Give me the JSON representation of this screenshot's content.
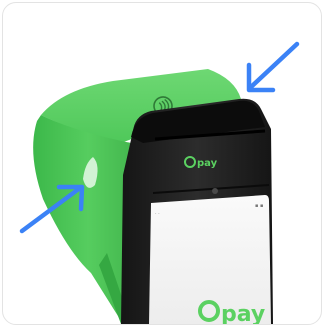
{
  "brand": {
    "logo_small": "pay",
    "logo_large": "pay",
    "accent_color": "#5bd161",
    "arrow_color": "#3b82f6"
  },
  "icons": [
    "contactless-icon",
    "arrow-icon",
    "arrow-icon"
  ]
}
